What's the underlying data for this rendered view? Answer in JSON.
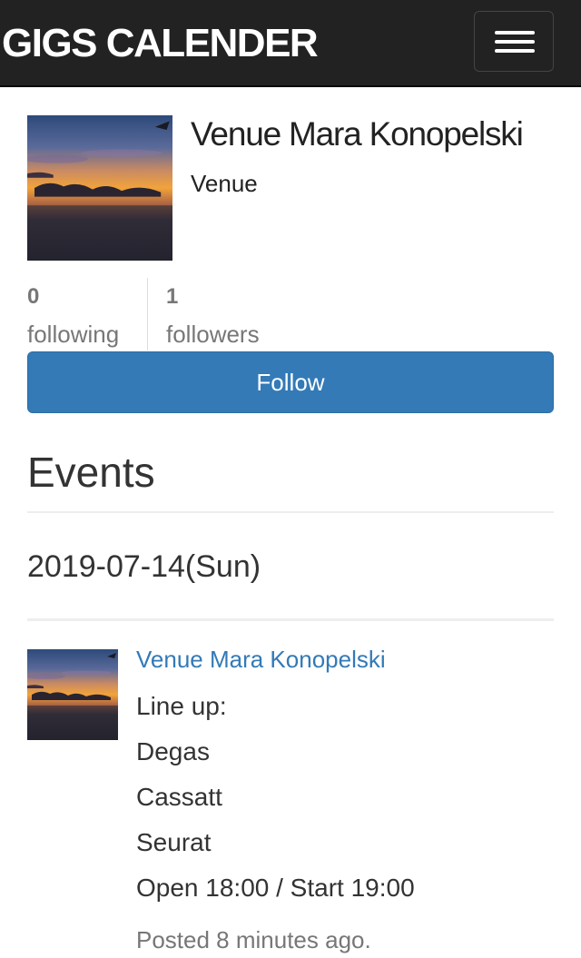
{
  "navbar": {
    "brand": "GIGS CALENDER",
    "menu_icon": "hamburger-menu-icon"
  },
  "profile": {
    "name": "Venue Mara Konopelski",
    "type": "Venue",
    "image": "sunset-sky-photo",
    "following_count": "0",
    "following_label": "following",
    "followers_count": "1",
    "followers_label": "followers",
    "follow_button": "Follow"
  },
  "events": {
    "heading": "Events",
    "groups": [
      {
        "date": "2019-07-14(Sun)",
        "items": [
          {
            "venue": "Venue Mara Konopelski",
            "image": "sunset-sky-photo",
            "lineup_label": "Line up:",
            "lineup": [
              "Degas",
              "Cassatt",
              "Seurat"
            ],
            "times": "Open 18:00 / Start 19:00",
            "posted": "Posted 8 minutes ago."
          }
        ]
      }
    ]
  },
  "colors": {
    "navbar_bg": "#222222",
    "primary": "#337ab7",
    "muted_text": "#777777",
    "body_text": "#333333"
  }
}
